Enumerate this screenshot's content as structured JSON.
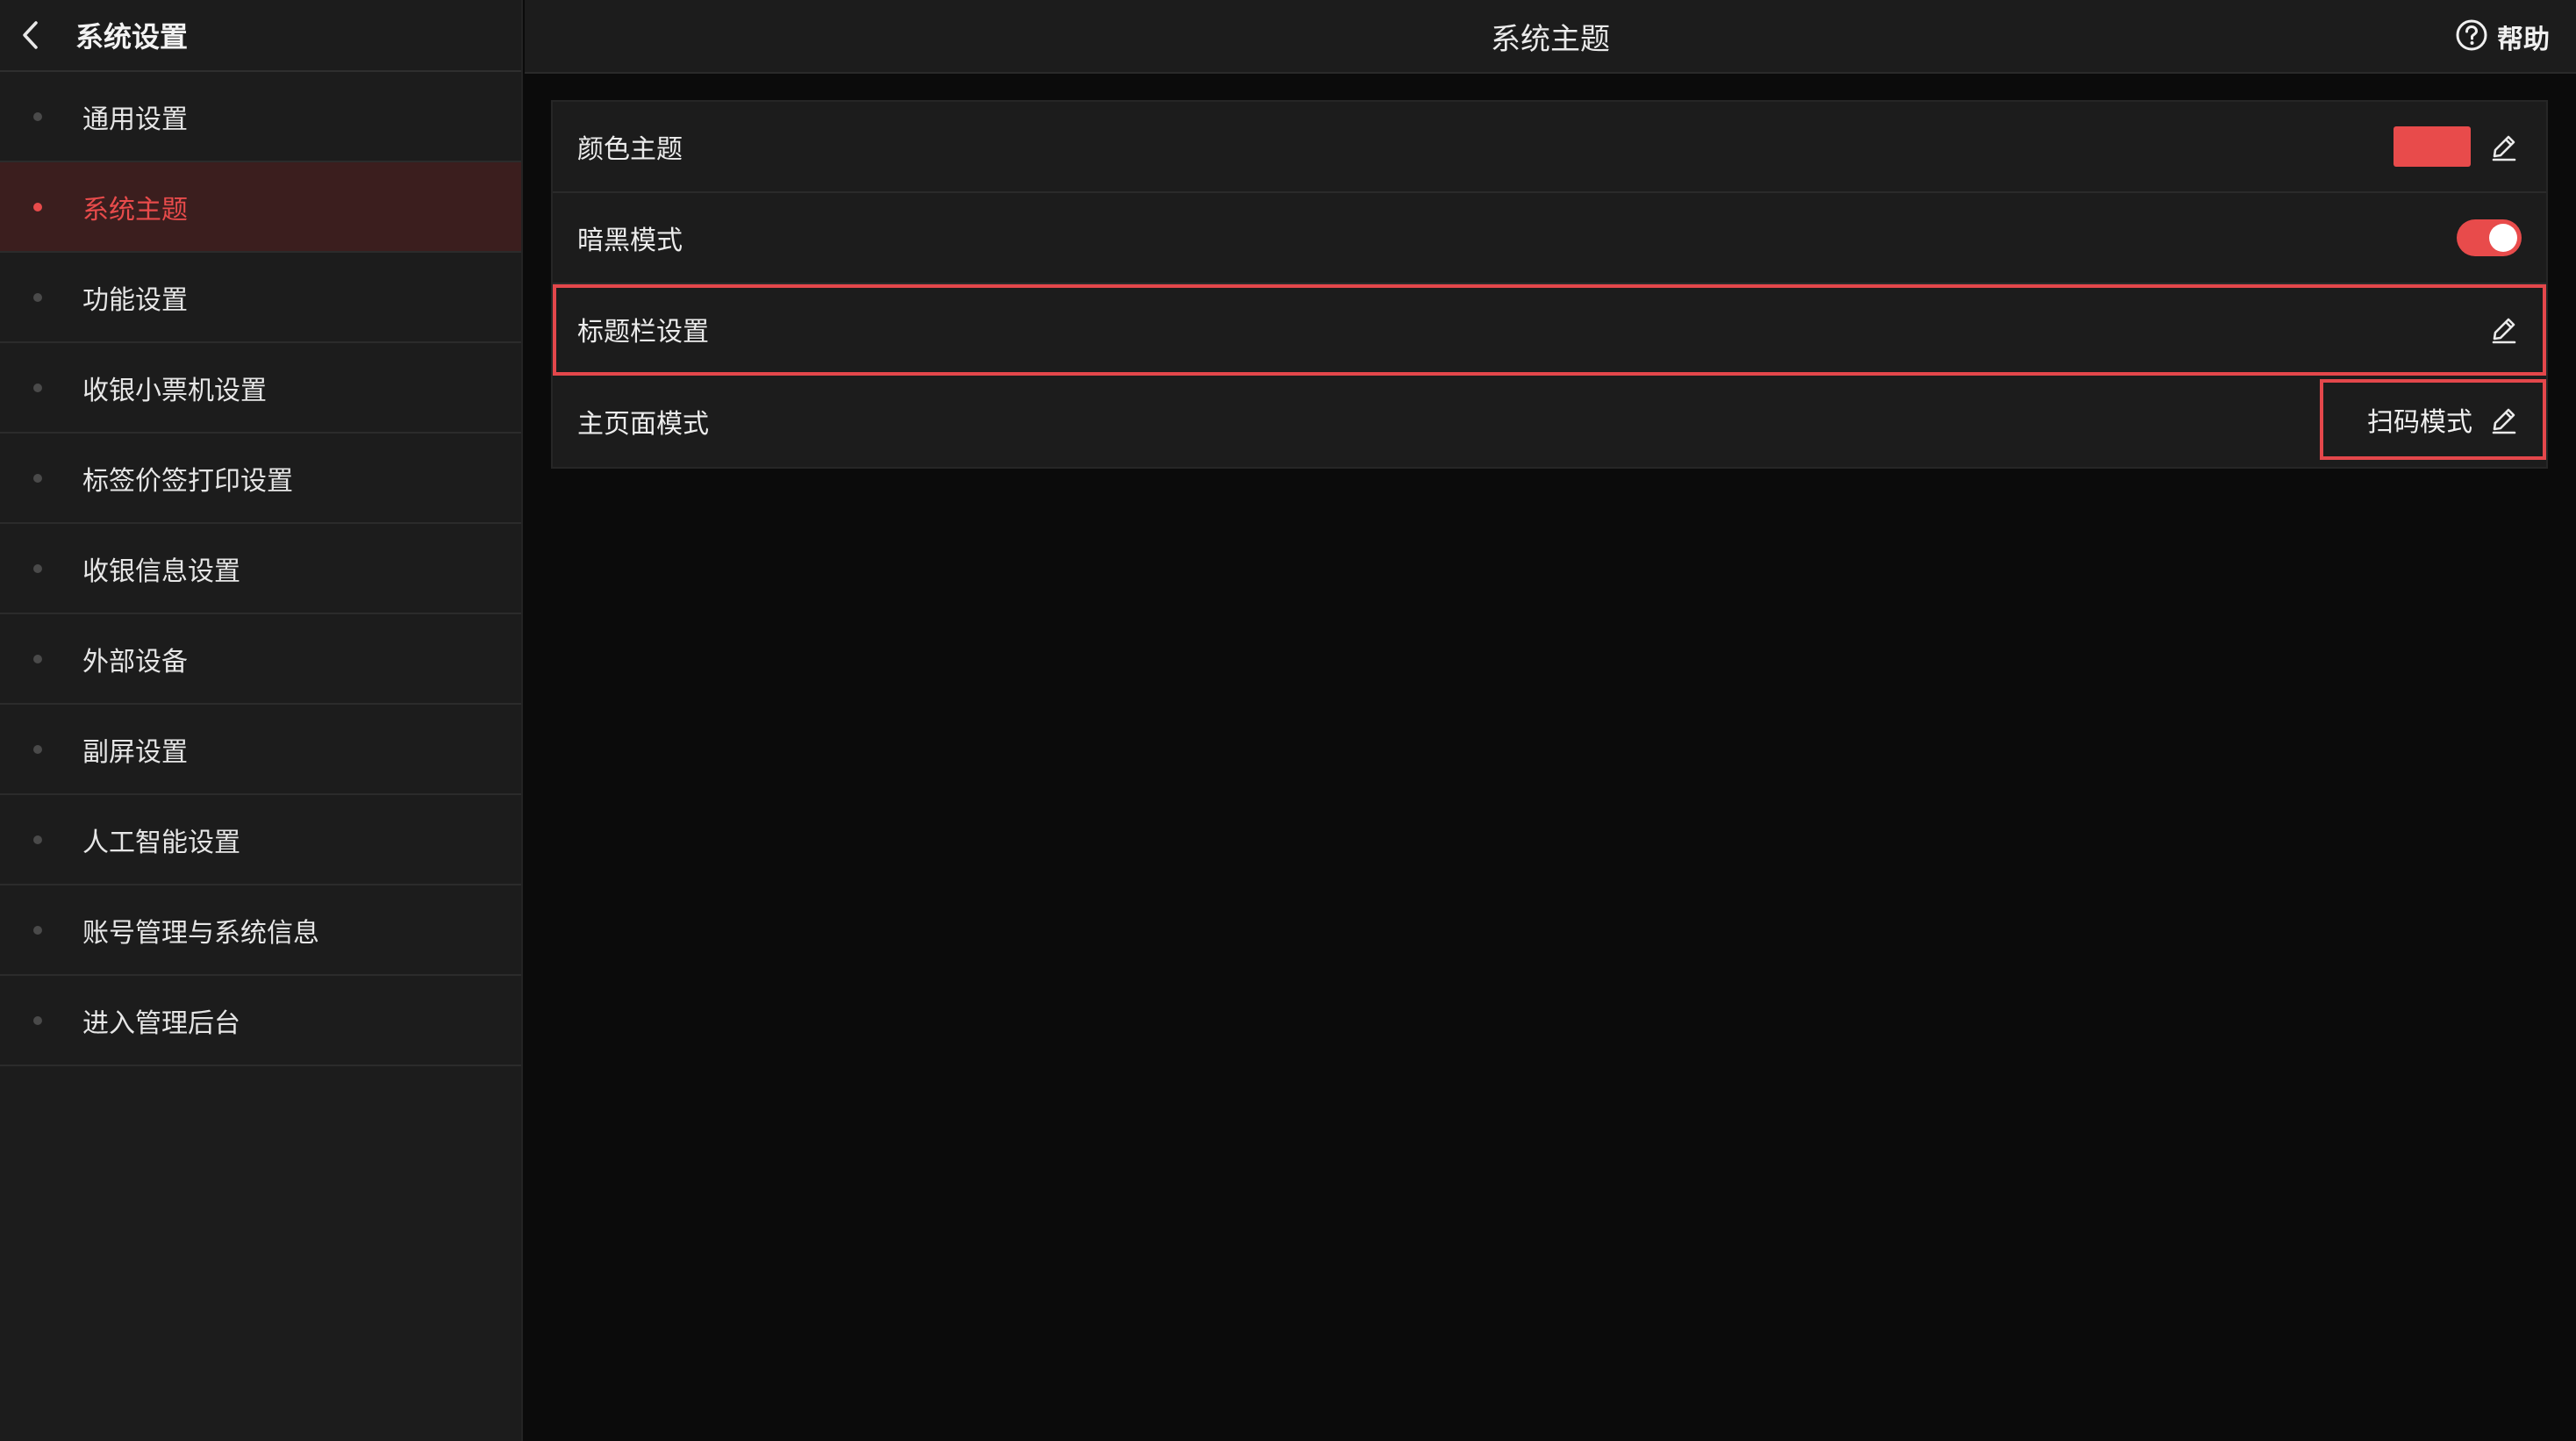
{
  "sidebar": {
    "title": "系统设置",
    "items": [
      {
        "label": "通用设置"
      },
      {
        "label": "系统主题",
        "active": true
      },
      {
        "label": "功能设置"
      },
      {
        "label": "收银小票机设置"
      },
      {
        "label": "标签价签打印设置"
      },
      {
        "label": "收银信息设置"
      },
      {
        "label": "外部设备"
      },
      {
        "label": "副屏设置"
      },
      {
        "label": "人工智能设置"
      },
      {
        "label": "账号管理与系统信息"
      },
      {
        "label": "进入管理后台"
      }
    ]
  },
  "header": {
    "title": "系统主题",
    "help_label": "帮助"
  },
  "settings": {
    "color_theme": {
      "label": "颜色主题",
      "color": "#e84b4b"
    },
    "dark_mode": {
      "label": "暗黑模式",
      "enabled": true
    },
    "titlebar": {
      "label": "标题栏设置"
    },
    "home_mode": {
      "label": "主页面模式",
      "value": "扫码模式"
    }
  },
  "colors": {
    "accent": "#e84b4b",
    "sidebar_bg": "#1c1c1c",
    "page_bg": "#0b0b0b"
  }
}
